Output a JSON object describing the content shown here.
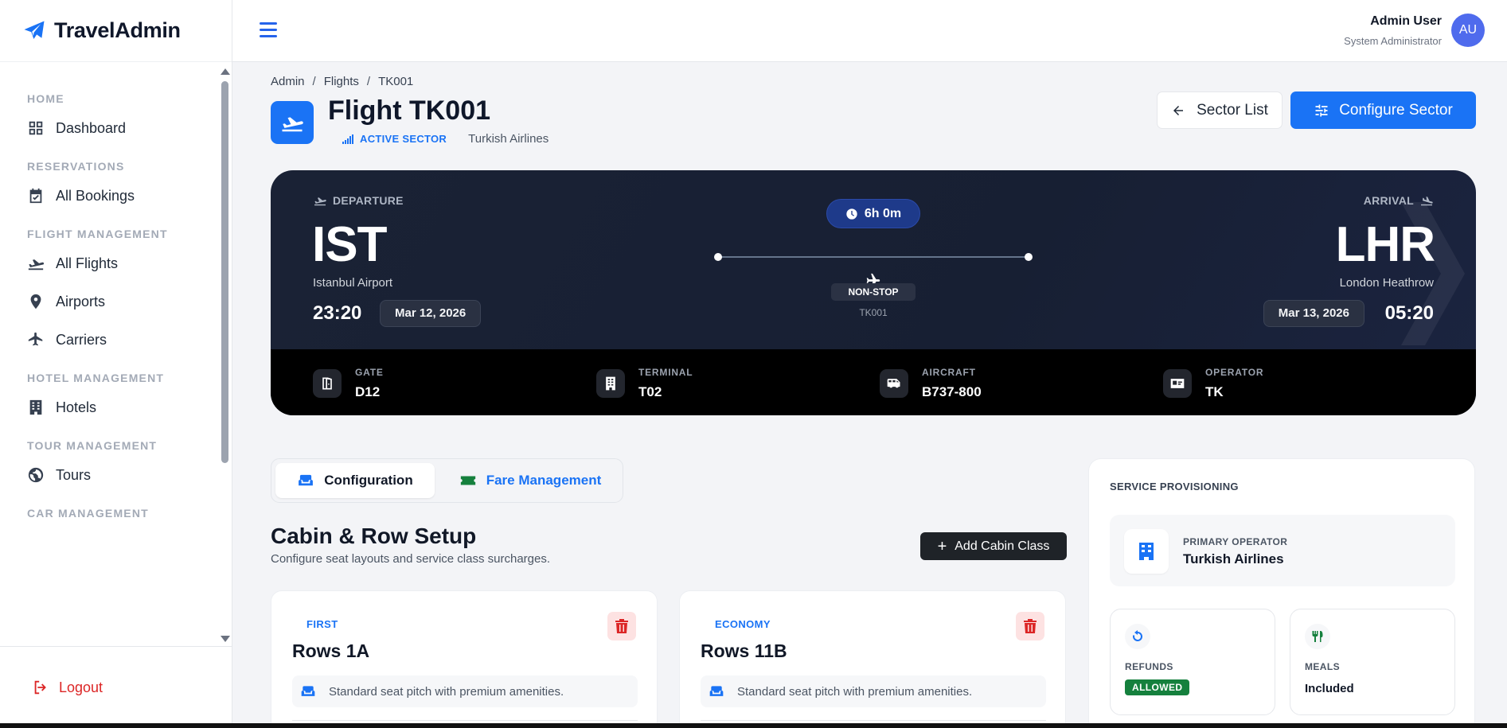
{
  "brand": {
    "name": "TravelAdmin"
  },
  "sidebar": {
    "sections": [
      {
        "title": "HOME",
        "items": [
          {
            "label": "Dashboard",
            "icon": "dashboard-icon"
          }
        ]
      },
      {
        "title": "RESERVATIONS",
        "items": [
          {
            "label": "All Bookings",
            "icon": "calendar-check-icon"
          }
        ]
      },
      {
        "title": "FLIGHT MANAGEMENT",
        "items": [
          {
            "label": "All Flights",
            "icon": "plane-departure-icon"
          },
          {
            "label": "Airports",
            "icon": "location-pin-icon"
          },
          {
            "label": "Carriers",
            "icon": "plane-icon"
          }
        ]
      },
      {
        "title": "HOTEL MANAGEMENT",
        "items": [
          {
            "label": "Hotels",
            "icon": "building-icon"
          }
        ]
      },
      {
        "title": "TOUR MANAGEMENT",
        "items": [
          {
            "label": "Tours",
            "icon": "globe-icon"
          }
        ]
      },
      {
        "title": "CAR MANAGEMENT",
        "items": []
      }
    ],
    "logout_label": "Logout"
  },
  "user": {
    "name": "Admin User",
    "role": "System Administrator",
    "initials": "AU"
  },
  "breadcrumb": [
    "Admin",
    "Flights",
    "TK001"
  ],
  "header": {
    "title": "Flight TK001",
    "status": "ACTIVE SECTOR",
    "airline": "Turkish Airlines",
    "sector_list_label": "Sector List",
    "configure_label": "Configure Sector"
  },
  "flight": {
    "departure_label": "DEPARTURE",
    "arrival_label": "ARRIVAL",
    "origin_code": "IST",
    "origin_name": "Istanbul Airport",
    "dest_code": "LHR",
    "dest_name": "London Heathrow",
    "dep_time": "23:20",
    "dep_date": "Mar 12, 2026",
    "arr_time": "05:20",
    "arr_date": "Mar 13, 2026",
    "duration": "6h 0m",
    "stops": "NON-STOP",
    "flight_no": "TK001",
    "info": [
      {
        "label": "GATE",
        "value": "D12",
        "icon": "door-icon"
      },
      {
        "label": "TERMINAL",
        "value": "T02",
        "icon": "building-icon"
      },
      {
        "label": "AIRCRAFT",
        "value": "B737-800",
        "icon": "shuttle-van-icon"
      },
      {
        "label": "OPERATOR",
        "value": "TK",
        "icon": "id-card-icon"
      }
    ]
  },
  "tabs": [
    {
      "label": "Configuration",
      "active": true
    },
    {
      "label": "Fare Management",
      "active": false
    }
  ],
  "cabin": {
    "title": "Cabin & Row Setup",
    "subtitle": "Configure seat layouts and service class surcharges.",
    "add_label": "Add Cabin Class",
    "cards": [
      {
        "class": "FIRST",
        "rows": "Rows 1A",
        "desc": "Standard seat pitch with premium amenities."
      },
      {
        "class": "ECONOMY",
        "rows": "Rows 11B",
        "desc": "Standard seat pitch with premium amenities."
      }
    ]
  },
  "service": {
    "title": "SERVICE PROVISIONING",
    "operator_label": "PRIMARY OPERATOR",
    "operator_value": "Turkish Airlines",
    "refunds_label": "REFUNDS",
    "refunds_value": "ALLOWED",
    "meals_label": "MEALS",
    "meals_value": "Included"
  },
  "colors": {
    "accent": "#1a73f5",
    "card_dark": "#1a2235",
    "danger": "#dc2626",
    "success": "#15803d"
  }
}
